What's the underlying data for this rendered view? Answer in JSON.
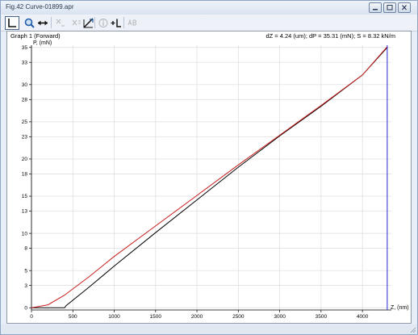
{
  "window": {
    "title": "Fig.42  Curve-01899.apr",
    "buttons": [
      "minimize",
      "restore",
      "close"
    ]
  },
  "toolbar": {
    "items": [
      {
        "icon": "axis-icon",
        "label": "L",
        "active": true
      },
      {
        "icon": "zoom-icon",
        "label": "",
        "active": false
      },
      {
        "icon": "pan-icon",
        "label": "",
        "active": false
      },
      {
        "icon": "x-marker-icon",
        "label": "",
        "active": false,
        "disabled": true
      },
      {
        "icon": "x-sub-icon",
        "label": "",
        "active": false,
        "disabled": true
      },
      {
        "icon": "slope-icon",
        "label": "",
        "active": false
      },
      {
        "icon": "info-icon",
        "label": "",
        "active": false,
        "disabled": true
      },
      {
        "icon": "add-line-icon",
        "label": "+L",
        "active": false
      },
      {
        "icon": "ab-icon",
        "label": "",
        "active": false,
        "disabled": true
      }
    ]
  },
  "chart_data": {
    "type": "line",
    "title": "Graph 1 (Forward)",
    "annotation": "dZ = 4.24 (um); dP = 35.31 (mN); S = 8.32 kN/m",
    "xlabel": "Z, (nm)",
    "ylabel": "P, (mN)",
    "xlim": [
      0,
      4350
    ],
    "ylim": [
      -0.3,
      35.3
    ],
    "xticks": [
      0,
      500,
      1000,
      1500,
      2000,
      2500,
      3000,
      3500,
      4000
    ],
    "yticks": [
      0,
      3,
      5,
      8,
      10,
      13,
      15,
      18,
      20,
      23,
      25,
      28,
      30,
      33,
      35
    ],
    "grid": true,
    "cursor_x": 4300,
    "series": [
      {
        "color": "#000000",
        "x": [
          0,
          400,
          420,
          700,
          1000,
          1500,
          2000,
          2500,
          3000,
          3500,
          4000,
          4300
        ],
        "y": [
          0,
          0,
          0.3,
          2.8,
          5.6,
          10.1,
          14.5,
          18.9,
          23.1,
          27.1,
          31.3,
          35.0
        ]
      },
      {
        "color": "#c81e1e",
        "x": [
          0,
          200,
          400,
          700,
          1000,
          1500,
          2000,
          2500,
          3000,
          3500,
          4000,
          4300
        ],
        "y": [
          0,
          0.4,
          1.7,
          4.2,
          6.9,
          11.0,
          15.1,
          19.2,
          23.2,
          27.2,
          31.3,
          35.1
        ]
      }
    ]
  }
}
